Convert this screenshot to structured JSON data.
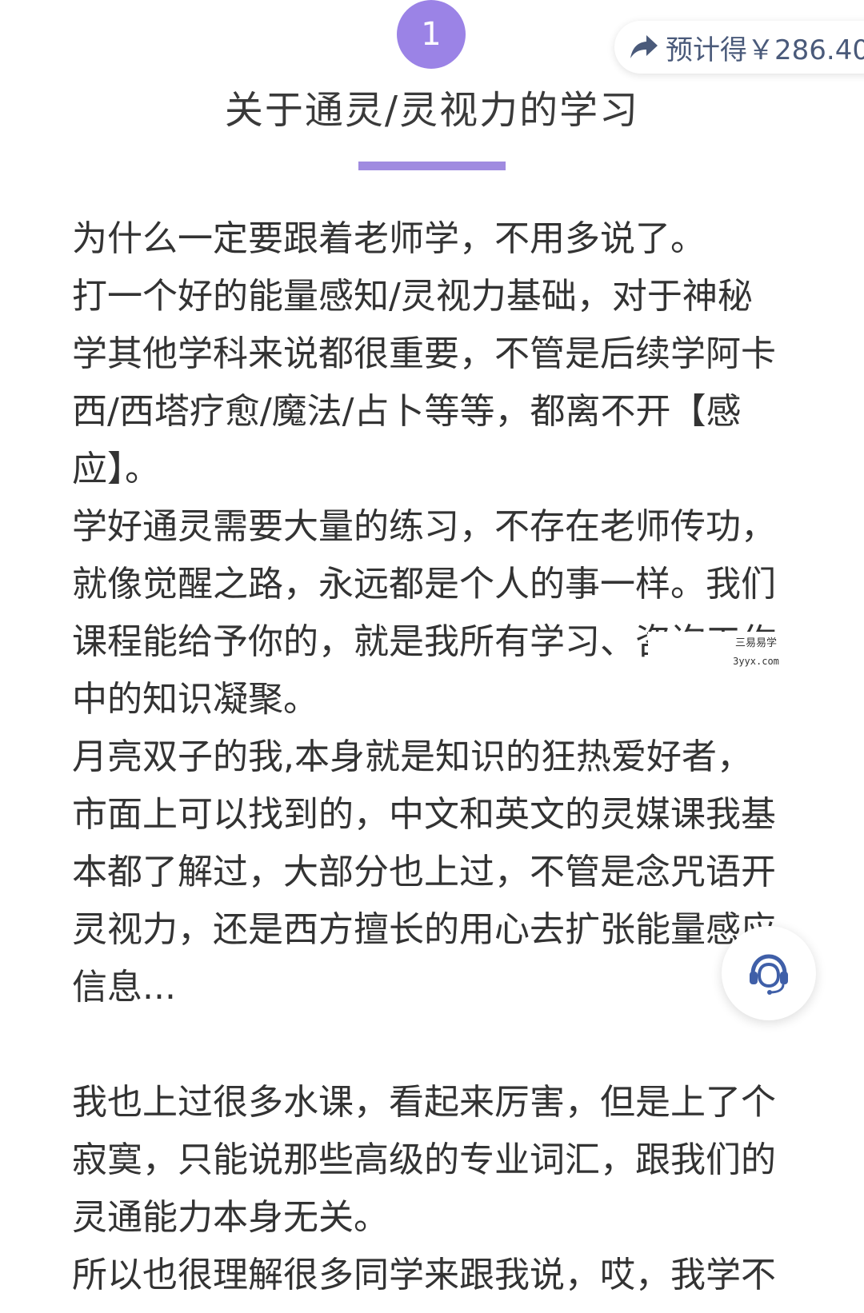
{
  "header": {
    "step_number": "1",
    "estimate_label": "预计得￥286.40",
    "section_title": "关于通灵/灵视力的学习"
  },
  "content": {
    "lines": [
      "为什么一定要跟着老师学，不用多说了。",
      "打一个好的能量感知/灵视力基础，对于神秘",
      "学其他学科来说都很重要，不管是后续学阿卡",
      "西/西塔疗愈/魔法/占卜等等，都离不开【感",
      "应】。",
      "学好通灵需要大量的练习，不存在老师传功，",
      "就像觉醒之路，永远都是个人的事一样。我们",
      "课程能给予你的，就是我所有学习、咨询工作",
      "中的知识凝聚。",
      "月亮双子的我,本身就是知识的狂热爱好者，",
      "市面上可以找到的，中文和英文的灵媒课我基",
      "本都了解过，大部分也上过，不管是念咒语开",
      "灵视力，还是西方擅长的用心去扩张能量感应",
      "信息...",
      "",
      "我也上过很多水课，看起来厉害，但是上了个",
      "寂寞，只能说那些高级的专业词汇，跟我们的",
      "灵通能力本身无关。",
      "所以也很理解很多同学来跟我说，哎，我学不"
    ]
  },
  "watermark": {
    "name": "三易易学",
    "site": "3yyx.com"
  },
  "icons": {
    "share": "share-arrow-icon",
    "support": "customer-service-headset-icon"
  },
  "colors": {
    "accent": "#9b83e6",
    "underline": "#a08be0",
    "estimate_text": "#4a5a7a",
    "body_text": "#333333",
    "support_icon": "#3f5fa8"
  }
}
